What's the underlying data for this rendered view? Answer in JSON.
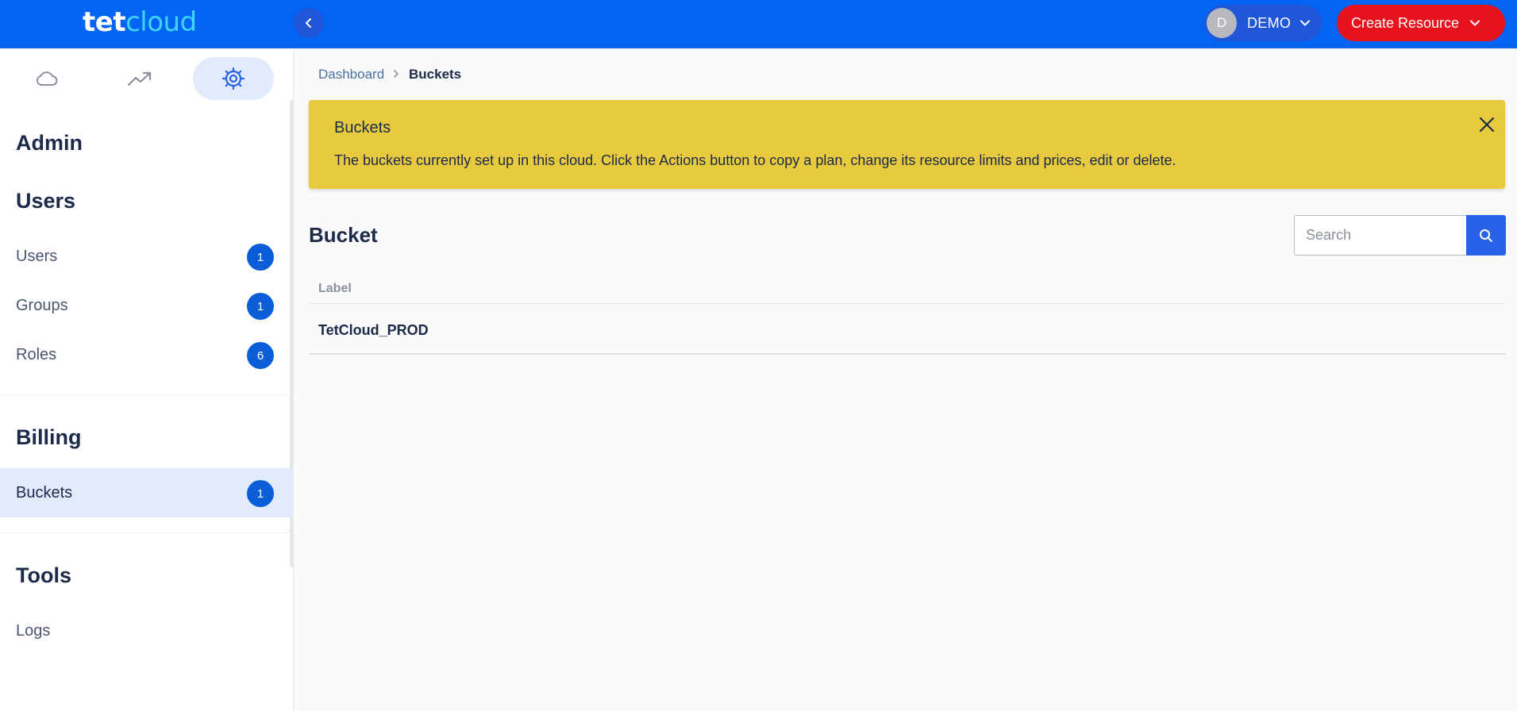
{
  "header": {
    "logo_part1": "tet",
    "logo_part2": "cloud",
    "user": {
      "initial": "D",
      "name": "DEMO"
    },
    "create_button": "Create Resource"
  },
  "sidebar": {
    "tabs": [
      {
        "icon": "cloud-icon",
        "active": false
      },
      {
        "icon": "trending-up-icon",
        "active": false
      },
      {
        "icon": "gear-icon",
        "active": true
      }
    ],
    "admin_title": "Admin",
    "users_section": {
      "title": "Users",
      "items": [
        {
          "label": "Users",
          "count": "1"
        },
        {
          "label": "Groups",
          "count": "1"
        },
        {
          "label": "Roles",
          "count": "6"
        }
      ]
    },
    "billing_section": {
      "title": "Billing",
      "items": [
        {
          "label": "Buckets",
          "count": "1",
          "active": true
        }
      ]
    },
    "tools_section": {
      "title": "Tools",
      "items": [
        {
          "label": "Logs"
        }
      ]
    }
  },
  "breadcrumb": {
    "parent": "Dashboard",
    "current": "Buckets"
  },
  "alert": {
    "title": "Buckets",
    "text": "The buckets currently set up in this cloud. Click the Actions button to copy a plan, change its resource limits and prices, edit or delete.",
    "color": "#e8ca3f"
  },
  "main": {
    "title": "Bucket",
    "search": {
      "placeholder": "Search",
      "value": ""
    },
    "table": {
      "columns": [
        "Label"
      ],
      "rows": [
        {
          "label": "TetCloud_PROD"
        }
      ]
    }
  },
  "colors": {
    "brand_blue": "#0264f2",
    "create_red": "#e8121c",
    "badge_blue": "#0b5ed7"
  }
}
